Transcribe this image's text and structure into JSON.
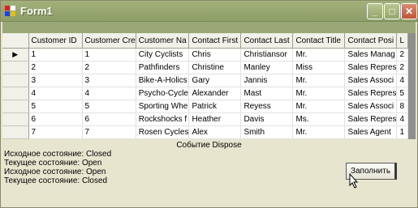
{
  "window": {
    "title": "Form1",
    "minimize_icon": "minimize-icon",
    "maximize_icon": "maximize-icon",
    "close_icon": "close-icon"
  },
  "grid": {
    "columns": [
      "Customer ID",
      "Customer Cre",
      "Customer Na",
      "Contact First",
      "Contact Last",
      "Contact Title",
      "Contact Posi",
      "L"
    ],
    "rows": [
      [
        "1",
        "1",
        "City Cyclists",
        "Chris",
        "Christiansor",
        "Mr.",
        "Sales Manag",
        "2"
      ],
      [
        "2",
        "2",
        "Pathfinders",
        "Christine",
        "Manley",
        "Miss",
        "Sales Repres",
        "2"
      ],
      [
        "3",
        "3",
        "Bike-A-Holics",
        "Gary",
        "Jannis",
        "Mr.",
        "Sales Associ",
        "4"
      ],
      [
        "4",
        "4",
        "Psycho-Cycle",
        "Alexander",
        "Mast",
        "Mr.",
        "Sales Repres",
        "5"
      ],
      [
        "5",
        "5",
        "Sporting Whe",
        "Patrick",
        "Reyess",
        "Mr.",
        "Sales Associ",
        "8"
      ],
      [
        "6",
        "6",
        "Rockshocks f",
        "Heather",
        "Davis",
        "Ms.",
        "Sales Repres",
        "4"
      ],
      [
        "7",
        "7",
        "Rosen Cycles",
        "Alex",
        "Smith",
        "Mr.",
        "Sales Agent",
        "1"
      ]
    ],
    "current_row_marker": "▶"
  },
  "event_label": "Событие Dispose",
  "log": [
    "Исходное состояние: Closed",
    "Текущее состояние: Open",
    "Исходное состояние: Open",
    "Текущее состояние: Closed"
  ],
  "fill_button": {
    "label": "Заполнить"
  },
  "colors": {
    "titlebar": "#9aa878",
    "form_bg": "#e8e5cf",
    "grid_bg": "#8e8e8e",
    "close_button": "#c0543a"
  }
}
